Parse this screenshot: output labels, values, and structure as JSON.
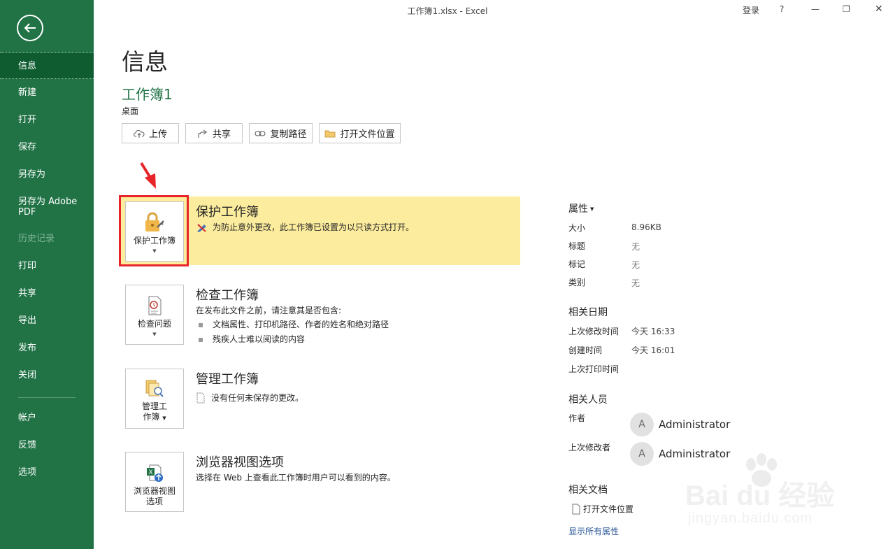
{
  "window": {
    "title": "工作簿1.xlsx  -  Excel",
    "signin": "登录",
    "help": "?",
    "minimize": "—",
    "restore": "❐",
    "close": "✕"
  },
  "nav": {
    "items": [
      {
        "label": "信息"
      },
      {
        "label": "新建"
      },
      {
        "label": "打开"
      },
      {
        "label": "保存"
      },
      {
        "label": "另存为"
      },
      {
        "label": "另存为 Adobe PDF"
      },
      {
        "label": "历史记录"
      },
      {
        "label": "打印"
      },
      {
        "label": "共享"
      },
      {
        "label": "导出"
      },
      {
        "label": "发布"
      },
      {
        "label": "关闭"
      },
      {
        "label": "帐户"
      },
      {
        "label": "反馈"
      },
      {
        "label": "选项"
      }
    ]
  },
  "page": {
    "title": "信息",
    "doc_name": "工作簿1",
    "location": "桌面",
    "actions": [
      "上传",
      "共享",
      "复制路径",
      "打开文件位置"
    ]
  },
  "sections": {
    "protect": {
      "tile_label": "保护工作簿",
      "title": "保护工作簿",
      "desc": "为防止意外更改，此工作簿已设置为以只读方式打开。"
    },
    "inspect": {
      "tile_label": "检查问题",
      "title": "检查工作簿",
      "desc": "在发布此文件之前，请注意其是否包含:",
      "bullets": [
        "文档属性、打印机路径、作者的姓名和绝对路径",
        "残疾人士难以阅读的内容"
      ]
    },
    "manage": {
      "tile_label_1": "管理工",
      "tile_label_2": "作簿",
      "title": "管理工作簿",
      "desc": "没有任何未保存的更改。"
    },
    "browser": {
      "tile_label_1": "浏览器视图",
      "tile_label_2": "选项",
      "title": "浏览器视图选项",
      "desc": "选择在 Web 上查看此工作簿时用户可以看到的内容。"
    }
  },
  "properties": {
    "heading": "属性",
    "size_label": "大小",
    "size_value": "8.96KB",
    "title_label": "标题",
    "title_value": "无",
    "tags_label": "标记",
    "tags_value": "无",
    "category_label": "类别",
    "category_value": "无",
    "dates_heading": "相关日期",
    "modified_label": "上次修改时间",
    "modified_value": "今天 16:33",
    "created_label": "创建时间",
    "created_value": "今天 16:01",
    "printed_label": "上次打印时间",
    "people_heading": "相关人员",
    "author_label": "作者",
    "author_name": "Administrator",
    "author_initial": "A",
    "modifier_label": "上次修改者",
    "modifier_name": "Administrator",
    "modifier_initial": "A",
    "docs_heading": "相关文档",
    "open_location": "打开文件位置",
    "show_all": "显示所有属性"
  },
  "watermark": {
    "brand": "Bai du 经验",
    "url": "jingyan.baidu.com"
  },
  "colors": {
    "sidebar": "#217346",
    "sidebar_active": "#0e5c30",
    "doc_name": "#217346",
    "protect_band": "#fcec9e",
    "highlight": "#e8242b",
    "link": "#2b579a"
  }
}
